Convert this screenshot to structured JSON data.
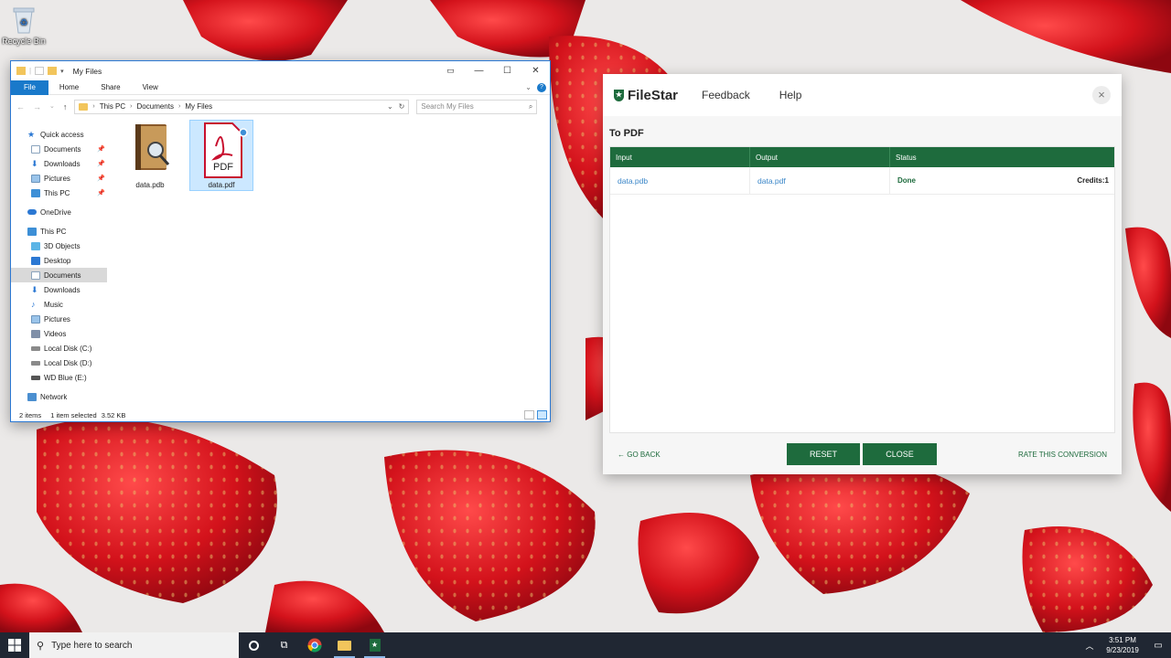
{
  "desktop": {
    "recycle_bin_label": "Recycle Bin"
  },
  "explorer": {
    "title": "My Files",
    "ribbon_tabs": [
      "File",
      "Home",
      "Share",
      "View"
    ],
    "breadcrumb": [
      "This PC",
      "Documents",
      "My Files"
    ],
    "search_placeholder": "Search My Files",
    "nav_items": [
      {
        "label": "Quick access",
        "icon": "star-icon",
        "pinned": false
      },
      {
        "label": "Documents",
        "icon": "documents-icon",
        "pinned": true
      },
      {
        "label": "Downloads",
        "icon": "download-icon",
        "pinned": true
      },
      {
        "label": "Pictures",
        "icon": "pictures-icon",
        "pinned": true
      },
      {
        "label": "This PC",
        "icon": "computer-icon",
        "pinned": true
      },
      {
        "label": "OneDrive",
        "icon": "cloud-icon",
        "pinned": false
      },
      {
        "label": "This PC",
        "icon": "computer-icon",
        "pinned": false
      },
      {
        "label": "3D Objects",
        "icon": "cube-icon",
        "pinned": false
      },
      {
        "label": "Desktop",
        "icon": "desktop-icon",
        "pinned": false
      },
      {
        "label": "Documents",
        "icon": "documents-icon",
        "pinned": false,
        "selected": true
      },
      {
        "label": "Downloads",
        "icon": "download-icon",
        "pinned": false
      },
      {
        "label": "Music",
        "icon": "music-icon",
        "pinned": false
      },
      {
        "label": "Pictures",
        "icon": "pictures-icon",
        "pinned": false
      },
      {
        "label": "Videos",
        "icon": "video-icon",
        "pinned": false
      },
      {
        "label": "Local Disk (C:)",
        "icon": "drive-icon",
        "pinned": false
      },
      {
        "label": "Local Disk (D:)",
        "icon": "drive-icon",
        "pinned": false
      },
      {
        "label": "WD Blue (E:)",
        "icon": "drive-icon",
        "pinned": false
      },
      {
        "label": "Network",
        "icon": "network-icon",
        "pinned": false
      }
    ],
    "files": [
      {
        "name": "data.pdb",
        "icon": "ebook-icon",
        "selected": false
      },
      {
        "name": "data.pdf",
        "icon": "pdf-icon",
        "selected": true,
        "icon_text": "PDF"
      }
    ],
    "status": {
      "item_count": "2 items",
      "selection": "1 item selected",
      "size": "3.52 KB"
    }
  },
  "filestar": {
    "brand": "FileStar",
    "nav": [
      "Feedback",
      "Help"
    ],
    "section_title": "To PDF",
    "columns": [
      "Input",
      "Output",
      "Status"
    ],
    "rows": [
      {
        "input": "data.pdb",
        "output": "data.pdf",
        "status": "Done",
        "credits": "Credits:1"
      }
    ],
    "go_back": "GO BACK",
    "reset": "RESET",
    "close": "CLOSE",
    "rate": "RATE THIS CONVERSION",
    "accent_color": "#1e6b3d"
  },
  "taskbar": {
    "search_placeholder": "Type here to search",
    "time": "3:51 PM",
    "date": "9/23/2019"
  }
}
